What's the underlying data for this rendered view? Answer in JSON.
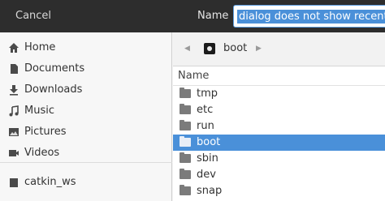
{
  "header": {
    "cancel_label": "Cancel",
    "name_label": "Name",
    "name_value": "dialog does not show recently o"
  },
  "sidebar": {
    "items": [
      {
        "label": "Home",
        "icon": "home-icon"
      },
      {
        "label": "Documents",
        "icon": "document-icon"
      },
      {
        "label": "Downloads",
        "icon": "download-icon"
      },
      {
        "label": "Music",
        "icon": "music-icon"
      },
      {
        "label": "Pictures",
        "icon": "picture-icon"
      },
      {
        "label": "Videos",
        "icon": "video-icon"
      },
      {
        "label": "catkin_ws",
        "icon": "folder-icon"
      }
    ]
  },
  "pathbar": {
    "current": "boot"
  },
  "filelist": {
    "column_name": "Name",
    "rows": [
      {
        "label": "tmp",
        "selected": false
      },
      {
        "label": "etc",
        "selected": false
      },
      {
        "label": "run",
        "selected": false
      },
      {
        "label": "boot",
        "selected": true
      },
      {
        "label": "sbin",
        "selected": false
      },
      {
        "label": "dev",
        "selected": false
      },
      {
        "label": "snap",
        "selected": false
      }
    ]
  },
  "colors": {
    "header_bg": "#2d2d2d",
    "selection": "#4a90d9",
    "sidebar_bg": "#f7f7f7"
  }
}
